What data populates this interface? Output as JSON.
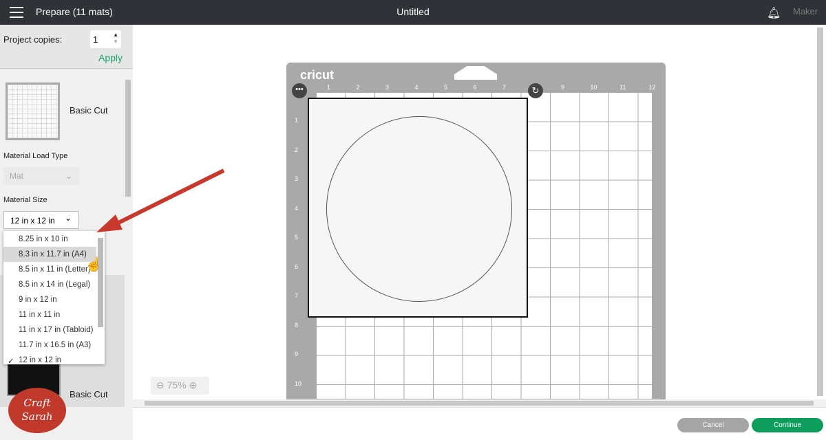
{
  "header": {
    "title": "Prepare (11 mats)",
    "document": "Untitled",
    "machine": "Maker"
  },
  "left": {
    "copies_label": "Project copies:",
    "copies_value": "1",
    "apply": "Apply",
    "mat1_label": "Basic Cut",
    "load_type_label": "Material Load Type",
    "load_type_value": "Mat",
    "size_label": "Material Size",
    "size_value": "12 in x 12 in",
    "size_options": [
      "8.25 in x 10 in",
      "8.3 in x 11.7 in (A4)",
      "8.5 in x 11 in (Letter)",
      "8.5 in x 14 in (Legal)",
      "9 in x 12 in",
      "11 in x 11 in",
      "11 in x 17 in (Tabloid)",
      "11.7 in x 16.5 in (A3)",
      "12 in x 12 in"
    ],
    "highlighted_option": "8.3 in x 11.7 in (A4)",
    "selected_option": "12 in x 12 in",
    "check": "✓",
    "mat2_label": "Basic Cut",
    "watermark": "Craft with Sarah"
  },
  "canvas": {
    "brand": "cricut",
    "top_ticks": [
      "1",
      "2",
      "3",
      "4",
      "5",
      "6",
      "7",
      "8",
      "9",
      "10",
      "11",
      "12"
    ],
    "left_ticks": [
      "1",
      "2",
      "3",
      "4",
      "5",
      "6",
      "7",
      "8",
      "9",
      "10"
    ],
    "zoom": "75%"
  },
  "footer": {
    "cancel": "Cancel",
    "continue": "Continue"
  },
  "colors": {
    "accent": "#1aa66a",
    "continue": "#0d9d5c",
    "arrow": "#c8392b"
  }
}
